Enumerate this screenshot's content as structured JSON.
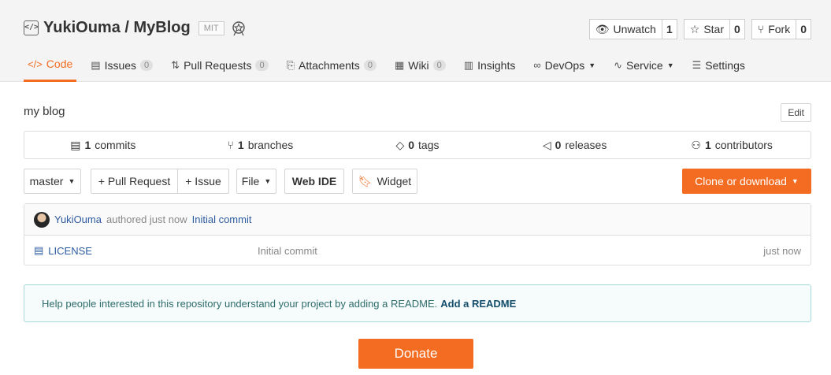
{
  "repo": {
    "title": "YukiOuma / MyBlog",
    "license": "MIT",
    "description": "my blog"
  },
  "actions": {
    "unwatch": {
      "label": "Unwatch",
      "count": "1"
    },
    "star": {
      "label": "Star",
      "count": "0"
    },
    "fork": {
      "label": "Fork",
      "count": "0"
    }
  },
  "nav": {
    "code": "Code",
    "issues": {
      "label": "Issues",
      "count": "0"
    },
    "pulls": {
      "label": "Pull Requests",
      "count": "0"
    },
    "attachments": {
      "label": "Attachments",
      "count": "0"
    },
    "wiki": {
      "label": "Wiki",
      "count": "0"
    },
    "insights": "Insights",
    "devops": "DevOps",
    "service": "Service",
    "settings": "Settings"
  },
  "edit_label": "Edit",
  "stats": {
    "commits": {
      "count": "1",
      "label": "commits"
    },
    "branches": {
      "count": "1",
      "label": "branches"
    },
    "tags": {
      "count": "0",
      "label": "tags"
    },
    "releases": {
      "count": "0",
      "label": "releases"
    },
    "contributors": {
      "count": "1",
      "label": "contributors"
    }
  },
  "toolbar": {
    "branch": "master",
    "pull_request": "+ Pull Request",
    "issue": "+ Issue",
    "file": "File",
    "web_ide": "Web IDE",
    "widget": "Widget",
    "clone": "Clone or download"
  },
  "commit": {
    "author": "YukiOuma",
    "meta": "authored just now",
    "message": "Initial commit"
  },
  "files": [
    {
      "name": "LICENSE",
      "commit": "Initial commit",
      "time": "just now"
    }
  ],
  "readme_hint": {
    "text": "Help people interested in this repository understand your project by adding a README.",
    "link": "Add a README"
  },
  "donate": "Donate",
  "colors": {
    "accent": "#f36c21",
    "link": "#2c5aa0"
  }
}
